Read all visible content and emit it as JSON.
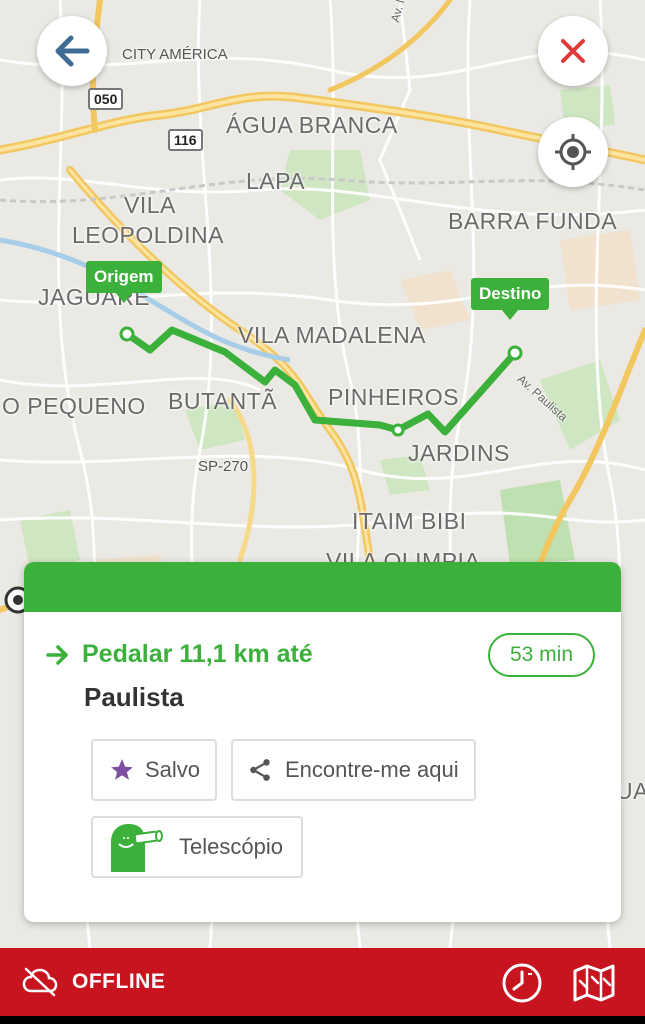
{
  "map": {
    "labels": {
      "city_america": "CITY AMÉRICA",
      "agua_branca": "ÁGUA BRANCA",
      "lapa": "LAPA",
      "vila": "VILA",
      "leopoldina": "LEOPOLDINA",
      "barra_funda": "BARRA FUNDA",
      "jaguare": "JAGUARÉ",
      "vila_madalena": "VILA MADALENA",
      "pinheiros": "PINHEIROS",
      "butanta": "BUTANTÃ",
      "o_pequeno": "O PEQUENO",
      "jardins": "JARDINS",
      "itaim_bibi": "ITAIM BIBI",
      "vila_olimpia": "VILA OLIMPIA",
      "av_inajar": "Av. Inajar de",
      "av_paulista": "Av. Paulista",
      "sp270": "SP-270",
      "road_050": "050",
      "road_116": "116",
      "partial_right": "UAI"
    },
    "origin_label": "Origem",
    "destination_label": "Destino",
    "route_color": "#3bb03b"
  },
  "buttons": {
    "back_icon": "arrow-left-icon",
    "close_icon": "close-icon",
    "locate_icon": "crosshair-icon"
  },
  "card": {
    "title": "Pedalar 11,1 km até",
    "destination": "Paulista",
    "duration": "53 min",
    "actions": {
      "saved": "Salvo",
      "meet_me": "Encontre-me aqui",
      "telescope": "Telescópio"
    }
  },
  "bottom_bar": {
    "status": "OFFLINE",
    "color": "#c8141e"
  }
}
